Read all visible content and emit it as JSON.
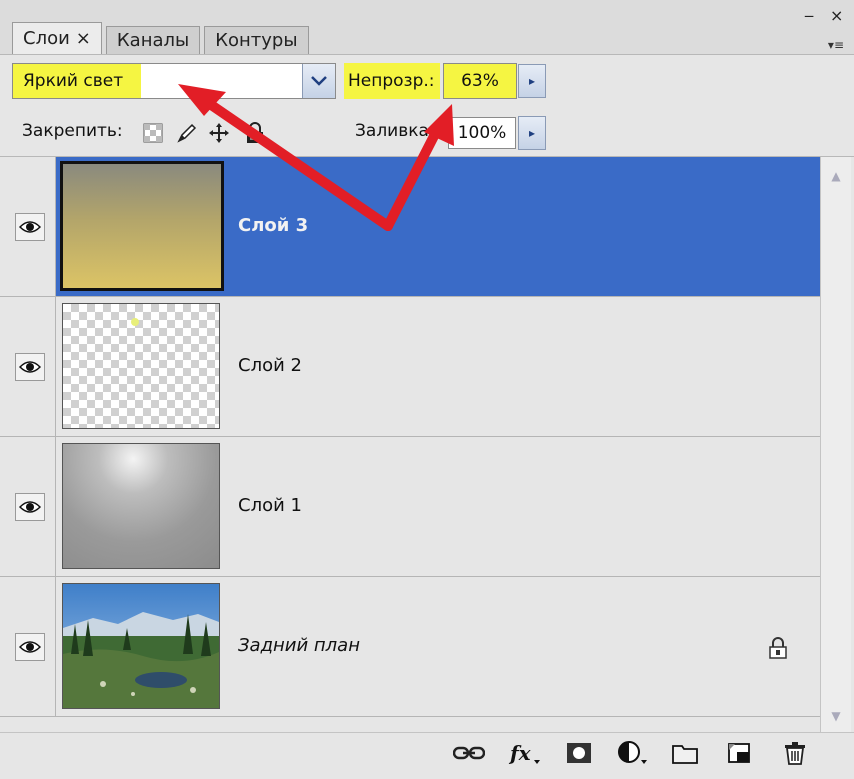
{
  "tabs": [
    {
      "label": "Слои",
      "close": "×"
    },
    {
      "label": "Каналы"
    },
    {
      "label": "Контуры"
    }
  ],
  "window": {
    "minimize": "‒",
    "close": "×",
    "menu": "▾≡"
  },
  "blend": {
    "mode": "Яркий свет",
    "arrow": "▾"
  },
  "opacity": {
    "label": "Непрозр.:",
    "value": "63%",
    "arrow": "▸"
  },
  "lock": {
    "label": "Закрепить:"
  },
  "fill": {
    "label": "Заливка:",
    "value": "100%",
    "arrow": "▸"
  },
  "layers": [
    {
      "name": "Слой 3",
      "visible": true,
      "selected": true
    },
    {
      "name": "Слой 2",
      "visible": true
    },
    {
      "name": "Слой 1",
      "visible": true
    },
    {
      "name": "Задний план",
      "visible": true,
      "locked": true
    }
  ],
  "scroll": {
    "up": "▲",
    "down": "▼"
  },
  "colors": {
    "accent_selected": "#3a6bc7",
    "highlight": "#f5f542",
    "arrow_red": "#e21e26"
  }
}
